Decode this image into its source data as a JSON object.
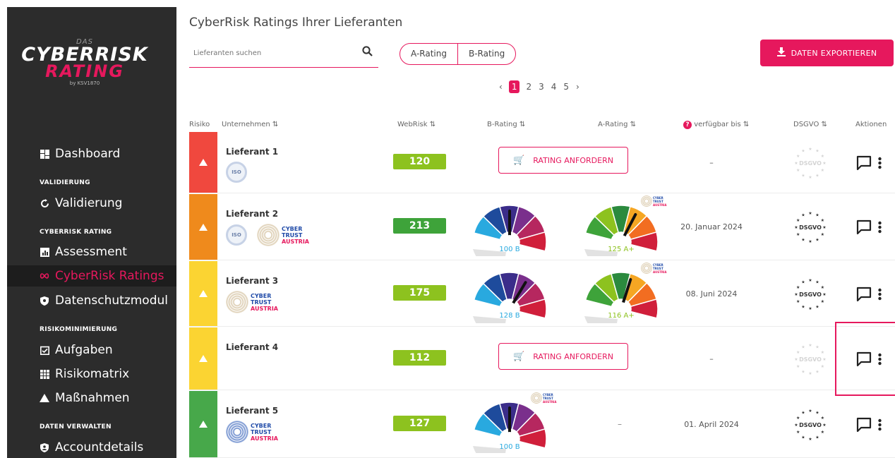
{
  "sidebar": {
    "logo": {
      "das": "DAS",
      "line1": "CYBERRISK",
      "line2": "RATING",
      "by": "by KSV1870"
    },
    "items": [
      {
        "type": "item",
        "label": "Dashboard",
        "icon": "dashboard-icon"
      },
      {
        "type": "section",
        "label": "VALIDIERUNG"
      },
      {
        "type": "item",
        "label": "Validierung",
        "icon": "validation-icon"
      },
      {
        "type": "section",
        "label": "CYBERRISK RATING"
      },
      {
        "type": "item",
        "label": "Assessment",
        "icon": "assessment-icon"
      },
      {
        "type": "item",
        "label": "CyberRisk Ratings",
        "icon": "infinity-icon",
        "active": true
      },
      {
        "type": "item",
        "label": "Datenschutzmodul",
        "icon": "shield-icon"
      },
      {
        "type": "section",
        "label": "RISIKOMINIMIERUNG"
      },
      {
        "type": "item",
        "label": "Aufgaben",
        "icon": "tasks-icon"
      },
      {
        "type": "item",
        "label": "Risikomatrix",
        "icon": "matrix-icon"
      },
      {
        "type": "item",
        "label": "Maßnahmen",
        "icon": "warning-icon"
      },
      {
        "type": "section",
        "label": "DATEN VERWALTEN"
      },
      {
        "type": "item",
        "label": "Accountdetails",
        "icon": "account-icon"
      }
    ]
  },
  "header": {
    "title": "CyberRisk Ratings Ihrer Lieferanten",
    "search_placeholder": "Lieferanten suchen",
    "toggle": [
      "A-Rating",
      "B-Rating"
    ],
    "export_label": "DATEN EXPORTIEREN"
  },
  "pager": {
    "prev": "‹",
    "pages": [
      "1",
      "2",
      "3",
      "4",
      "5"
    ],
    "current": "1",
    "next": "›"
  },
  "table": {
    "headers": {
      "risk": "Risiko",
      "company": "Unternehmen",
      "webrisk": "WebRisk",
      "brating": "B-Rating",
      "arating": "A-Rating",
      "available": "verfügbar bis",
      "dsgvo": "DSGVO",
      "actions": "Aktionen"
    },
    "request_label": "RATING ANFORDERN",
    "dash": "–",
    "dsgvo_label": "DSGVO",
    "iso_label": "ISO",
    "cyber_trust": [
      "CYBER",
      "TRUST",
      "AUSTRIA"
    ],
    "rows": [
      {
        "name": "Lieferant 1",
        "risk_color": "#f0483e",
        "webrisk": "120",
        "webrisk_color": "#8dc21f",
        "b_rating": null,
        "a_rating": null,
        "date": "–",
        "dsgvo_active": false,
        "logos": [
          "iso"
        ]
      },
      {
        "name": "Lieferant 2",
        "risk_color": "#ef8a1c",
        "webrisk": "213",
        "webrisk_color": "#3ea33a",
        "b_rating": {
          "label": "100 B",
          "value": 100
        },
        "a_rating": {
          "label": "125 A+",
          "value": 125
        },
        "date": "20. Januar 2024",
        "dsgvo_active": true,
        "logos": [
          "iso",
          "cyber"
        ]
      },
      {
        "name": "Lieferant 3",
        "risk_color": "#fbd432",
        "webrisk": "175",
        "webrisk_color": "#8dc21f",
        "b_rating": {
          "label": "128 B",
          "value": 128
        },
        "a_rating": {
          "label": "116 A+",
          "value": 116
        },
        "date": "08. Juni 2024",
        "dsgvo_active": true,
        "logos": [
          "cyber"
        ]
      },
      {
        "name": "Lieferant 4",
        "risk_color": "#fbd432",
        "webrisk": "112",
        "webrisk_color": "#8dc21f",
        "b_rating": null,
        "a_rating": null,
        "date": "–",
        "dsgvo_active": false,
        "logos": []
      },
      {
        "name": "Lieferant 5",
        "risk_color": "#47a84a",
        "webrisk": "127",
        "webrisk_color": "#8dc21f",
        "b_rating": {
          "label": "100 B",
          "value": 100
        },
        "a_rating": "dash",
        "date": "01. April 2024",
        "dsgvo_active": true,
        "logos": [
          "cyber-blue"
        ]
      }
    ]
  },
  "colors": {
    "accent": "#e6185d",
    "sidebar_bg": "#2c2c2c"
  }
}
